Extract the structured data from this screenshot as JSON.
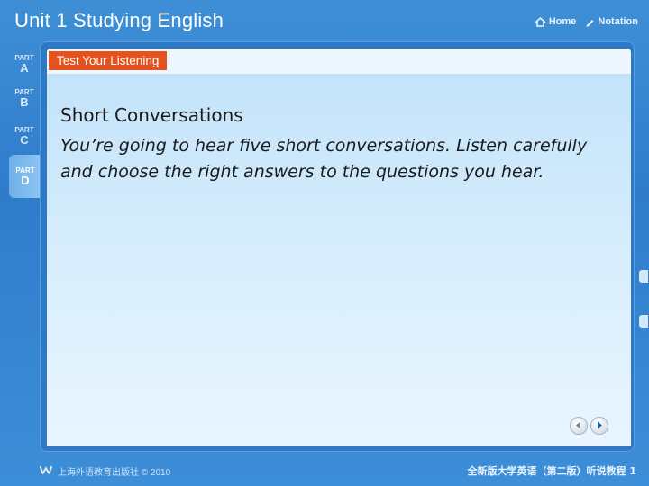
{
  "header": {
    "title": "Unit 1   Studying English",
    "nav": [
      {
        "label": "Home",
        "icon": "home-icon"
      },
      {
        "label": "Notation",
        "icon": "pencil-icon"
      }
    ]
  },
  "sidebar": {
    "tabs": [
      {
        "part": "PART",
        "letter": "A",
        "active": false
      },
      {
        "part": "PART",
        "letter": "B",
        "active": false
      },
      {
        "part": "PART",
        "letter": "C",
        "active": false
      },
      {
        "part": "PART",
        "letter": "D",
        "active": true
      }
    ]
  },
  "section": {
    "label": "Test Your Listening"
  },
  "content": {
    "heading": "Short Conversations",
    "body": "You’re going to hear five short conversations. Listen carefully and choose the right answers to the questions you hear."
  },
  "pager": {
    "prev_icon": "arrow-left-icon",
    "next_icon": "arrow-right-icon"
  },
  "footer": {
    "publisher": "上海外语教育出版社 © 2010",
    "course": "全新版大学英语（第二版）听说教程 1"
  },
  "colors": {
    "background": "#2f7ccb",
    "label_bg": "#e4531f",
    "content_bg": "#d6edfc"
  }
}
